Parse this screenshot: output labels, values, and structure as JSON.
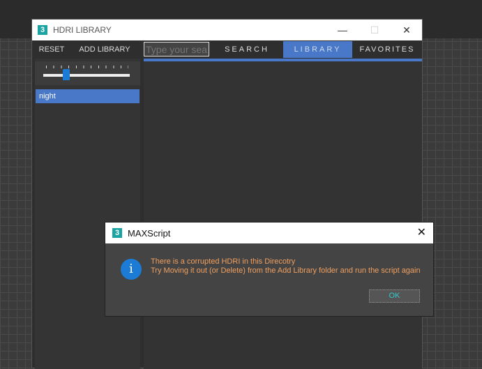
{
  "main_window": {
    "title": "HDRI LIBRARY",
    "app_icon": "3",
    "toolbar": {
      "reset": "RESET",
      "add_library": "ADD LIBRARY",
      "search_placeholder": "Type your sea",
      "search": "SEARCH",
      "library": "LIBRARY",
      "favorites": "FAVORITES"
    },
    "size_slider": {
      "value_fraction": 0.27
    },
    "list": [
      {
        "label": "night",
        "selected": true
      }
    ]
  },
  "dialog": {
    "title": "MAXScript",
    "app_icon": "3",
    "line1": "There is a corrupted HDRI in this Direcotry",
    "line2": "Try Moving it out (or Delete) from the Add Library folder and run the script again",
    "ok": "OK",
    "icon": "info-icon"
  },
  "colors": {
    "accent": "#4a78c8",
    "message": "#f0a060",
    "ok_text": "#33cccc"
  }
}
